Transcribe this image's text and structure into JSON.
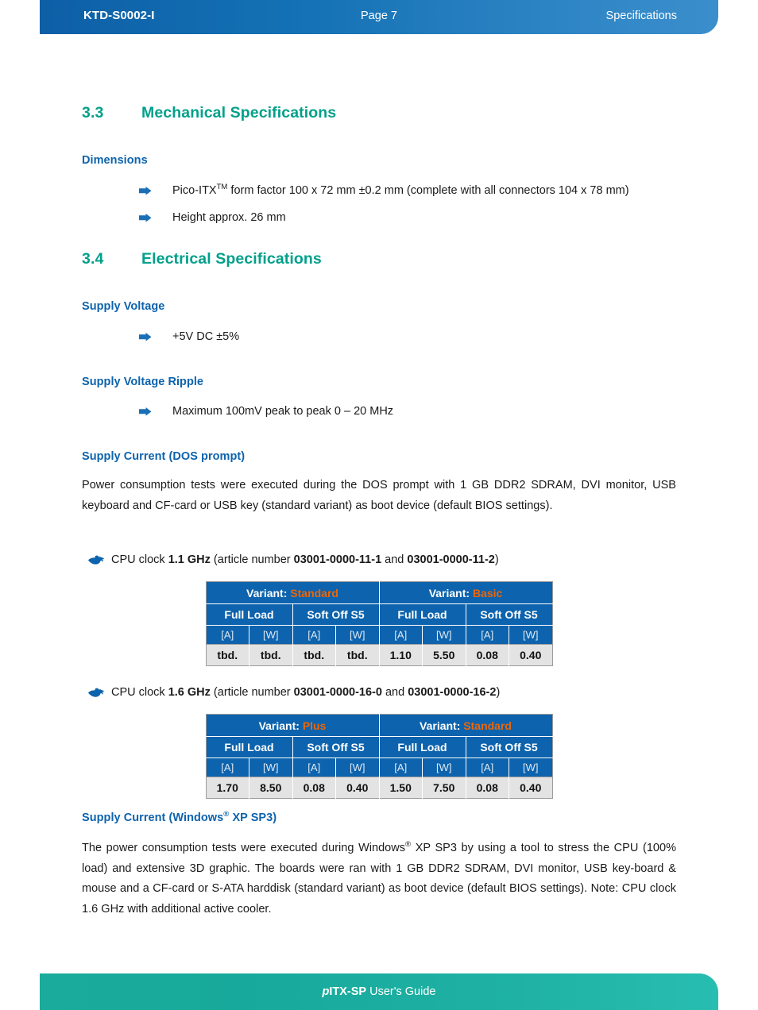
{
  "header": {
    "doc_id": "KTD-S0002-I",
    "page_label": "Page 7",
    "section_label": "Specifications"
  },
  "footer": {
    "brand_p": "p",
    "brand": "ITX-SP",
    "guide_label": " User's Guide"
  },
  "sections": {
    "mechanical": {
      "number": "3.3",
      "title": "Mechanical Specifications",
      "dimensions_heading": "Dimensions",
      "bullets": {
        "b1_pre": "Pico-ITX",
        "b1_sup": "TM",
        "b1_post": " form factor 100 x 72 mm  ±0.2 mm (complete with all connectors 104 x 78 mm)",
        "b2": "Height approx. 26 mm"
      }
    },
    "electrical": {
      "number": "3.4",
      "title": "Electrical Specifications",
      "supply_voltage_heading": "Supply Voltage",
      "supply_voltage_bullet": "+5V DC  ±5%",
      "ripple_heading": "Supply Voltage Ripple",
      "ripple_bullet": "Maximum 100mV peak to peak 0 – 20 MHz",
      "dos": {
        "heading": "Supply Current (DOS prompt)",
        "paragraph": "Power consumption tests were executed during the DOS prompt with 1 GB DDR2 SDRAM, DVI monitor, USB keyboard and CF-card or USB key (standard variant) as boot device (default BIOS settings).",
        "clock1": {
          "pre": "CPU clock ",
          "clock": "1.1 GHz",
          "mid": " (article number ",
          "art1": "03001-0000-11-1",
          "and": " and ",
          "art2": "03001-0000-11-2",
          "post": ")"
        },
        "clock2": {
          "pre": "CPU clock ",
          "clock": "1.6 GHz",
          "mid": " (article number ",
          "art1": "03001-0000-16-0",
          "and": " and ",
          "art2": "03001-0000-16-2",
          "post": ")"
        }
      },
      "windows": {
        "heading_pre": "Supply Current (Windows",
        "heading_sup": "®",
        "heading_post": " XP SP3)",
        "para_1": "The power consumption tests were executed during Windows",
        "para_sup": "®",
        "para_2": " XP SP3 by using a tool to stress the CPU (100% load) and extensive 3D graphic. The boards were ran with 1 GB DDR2 SDRAM, DVI monitor, USB key-board & mouse and a CF-card or S-ATA harddisk (standard variant) as boot device (default BIOS settings). Note: CPU clock 1.6 GHz with additional active cooler."
      }
    }
  },
  "tables": {
    "table1": {
      "variant_label": "Variant:",
      "variant_a": "Standard",
      "variant_b": "Basic",
      "load_full": "Full Load",
      "load_soft": "Soft Off S5",
      "unit_a": "[A]",
      "unit_w": "[W]",
      "values": [
        "tbd.",
        "tbd.",
        "tbd.",
        "tbd.",
        "1.10",
        "5.50",
        "0.08",
        "0.40"
      ]
    },
    "table2": {
      "variant_label": "Variant:",
      "variant_a": "Plus",
      "variant_b": "Standard",
      "load_full": "Full Load",
      "load_soft": "Soft Off S5",
      "unit_a": "[A]",
      "unit_w": "[W]",
      "values": [
        "1.70",
        "8.50",
        "0.08",
        "0.40",
        "1.50",
        "7.50",
        "0.08",
        "0.40"
      ]
    }
  },
  "colors": {
    "header_blue_dark": "#0d5fa6",
    "header_blue_light": "#3b8ecc",
    "footer_teal": "#1bab9c",
    "section_heading_teal": "#00a08a",
    "sub_heading_blue": "#0d63ad",
    "variant_orange": "#ec6608",
    "table_header_blue": "#0d63ad",
    "table_data_gray": "#e3e3e3"
  }
}
